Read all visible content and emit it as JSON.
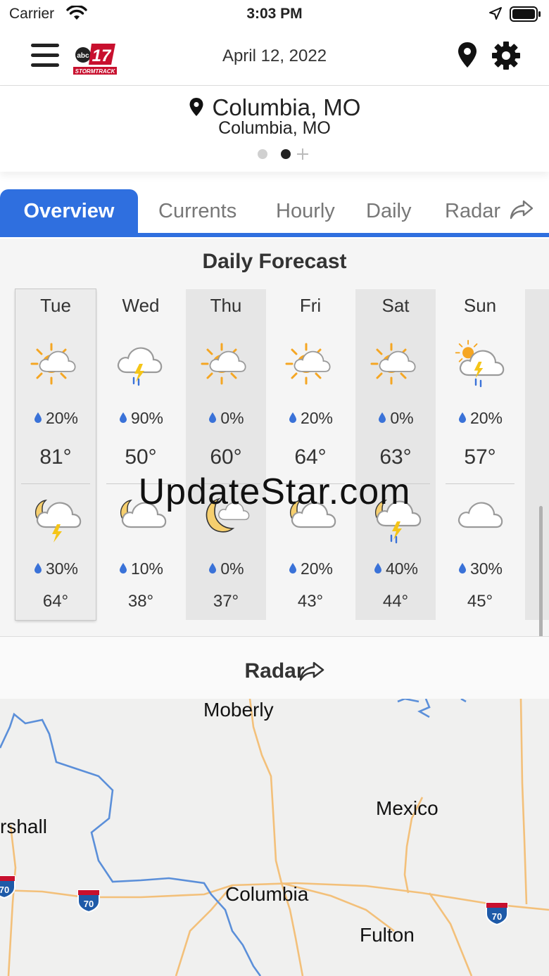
{
  "status_bar": {
    "carrier": "Carrier",
    "time": "3:03 PM"
  },
  "header": {
    "date": "April 12, 2022",
    "logo_text": "17"
  },
  "location": {
    "city": "Columbia, MO",
    "subtitle": "Columbia, MO"
  },
  "tabs": [
    {
      "label": "Overview",
      "active": true
    },
    {
      "label": "Currents"
    },
    {
      "label": "Hourly"
    },
    {
      "label": "Daily"
    },
    {
      "label": "Radar"
    }
  ],
  "forecast": {
    "title": "Daily Forecast",
    "days": [
      {
        "name": "Tue",
        "day_icon": "partly-sunny-icon",
        "day_precip": "20%",
        "high": "81°",
        "night_icon": "night-thunderstorm-icon",
        "night_precip": "30%",
        "low": "64°"
      },
      {
        "name": "Wed",
        "day_icon": "thunderstorm-rain-icon",
        "day_precip": "90%",
        "high": "50°",
        "night_icon": "partly-cloudy-night-icon",
        "night_precip": "10%",
        "low": "38°"
      },
      {
        "name": "Thu",
        "day_icon": "partly-sunny-icon",
        "day_precip": "0%",
        "high": "60°",
        "night_icon": "mostly-clear-night-icon",
        "night_precip": "0%",
        "low": "37°"
      },
      {
        "name": "Fri",
        "day_icon": "partly-sunny-icon",
        "day_precip": "20%",
        "high": "64°",
        "night_icon": "partly-cloudy-night-icon",
        "night_precip": "20%",
        "low": "43°"
      },
      {
        "name": "Sat",
        "day_icon": "partly-sunny-icon",
        "day_precip": "0%",
        "high": "63°",
        "night_icon": "night-thunderstorm-rain-icon",
        "night_precip": "40%",
        "low": "44°"
      },
      {
        "name": "Sun",
        "day_icon": "sun-thunderstorm-icon",
        "day_precip": "20%",
        "high": "57°",
        "night_icon": "cloudy-icon",
        "night_precip": "30%",
        "low": "45°"
      }
    ]
  },
  "watermark": "UpdateStar.com",
  "radar": {
    "label": "Radar"
  },
  "map": {
    "cities": [
      "Moberly",
      "Mexico",
      "rshall",
      "Columbia",
      "Fulton"
    ],
    "highway_label": "70"
  },
  "colors": {
    "accent": "#2f6fdf",
    "sun": "#f5a623",
    "moon": "#f6cf6e",
    "bolt": "#f5c518",
    "rain": "#3a72d8",
    "river": "#5b8fd9",
    "road": "#f3c07a"
  }
}
